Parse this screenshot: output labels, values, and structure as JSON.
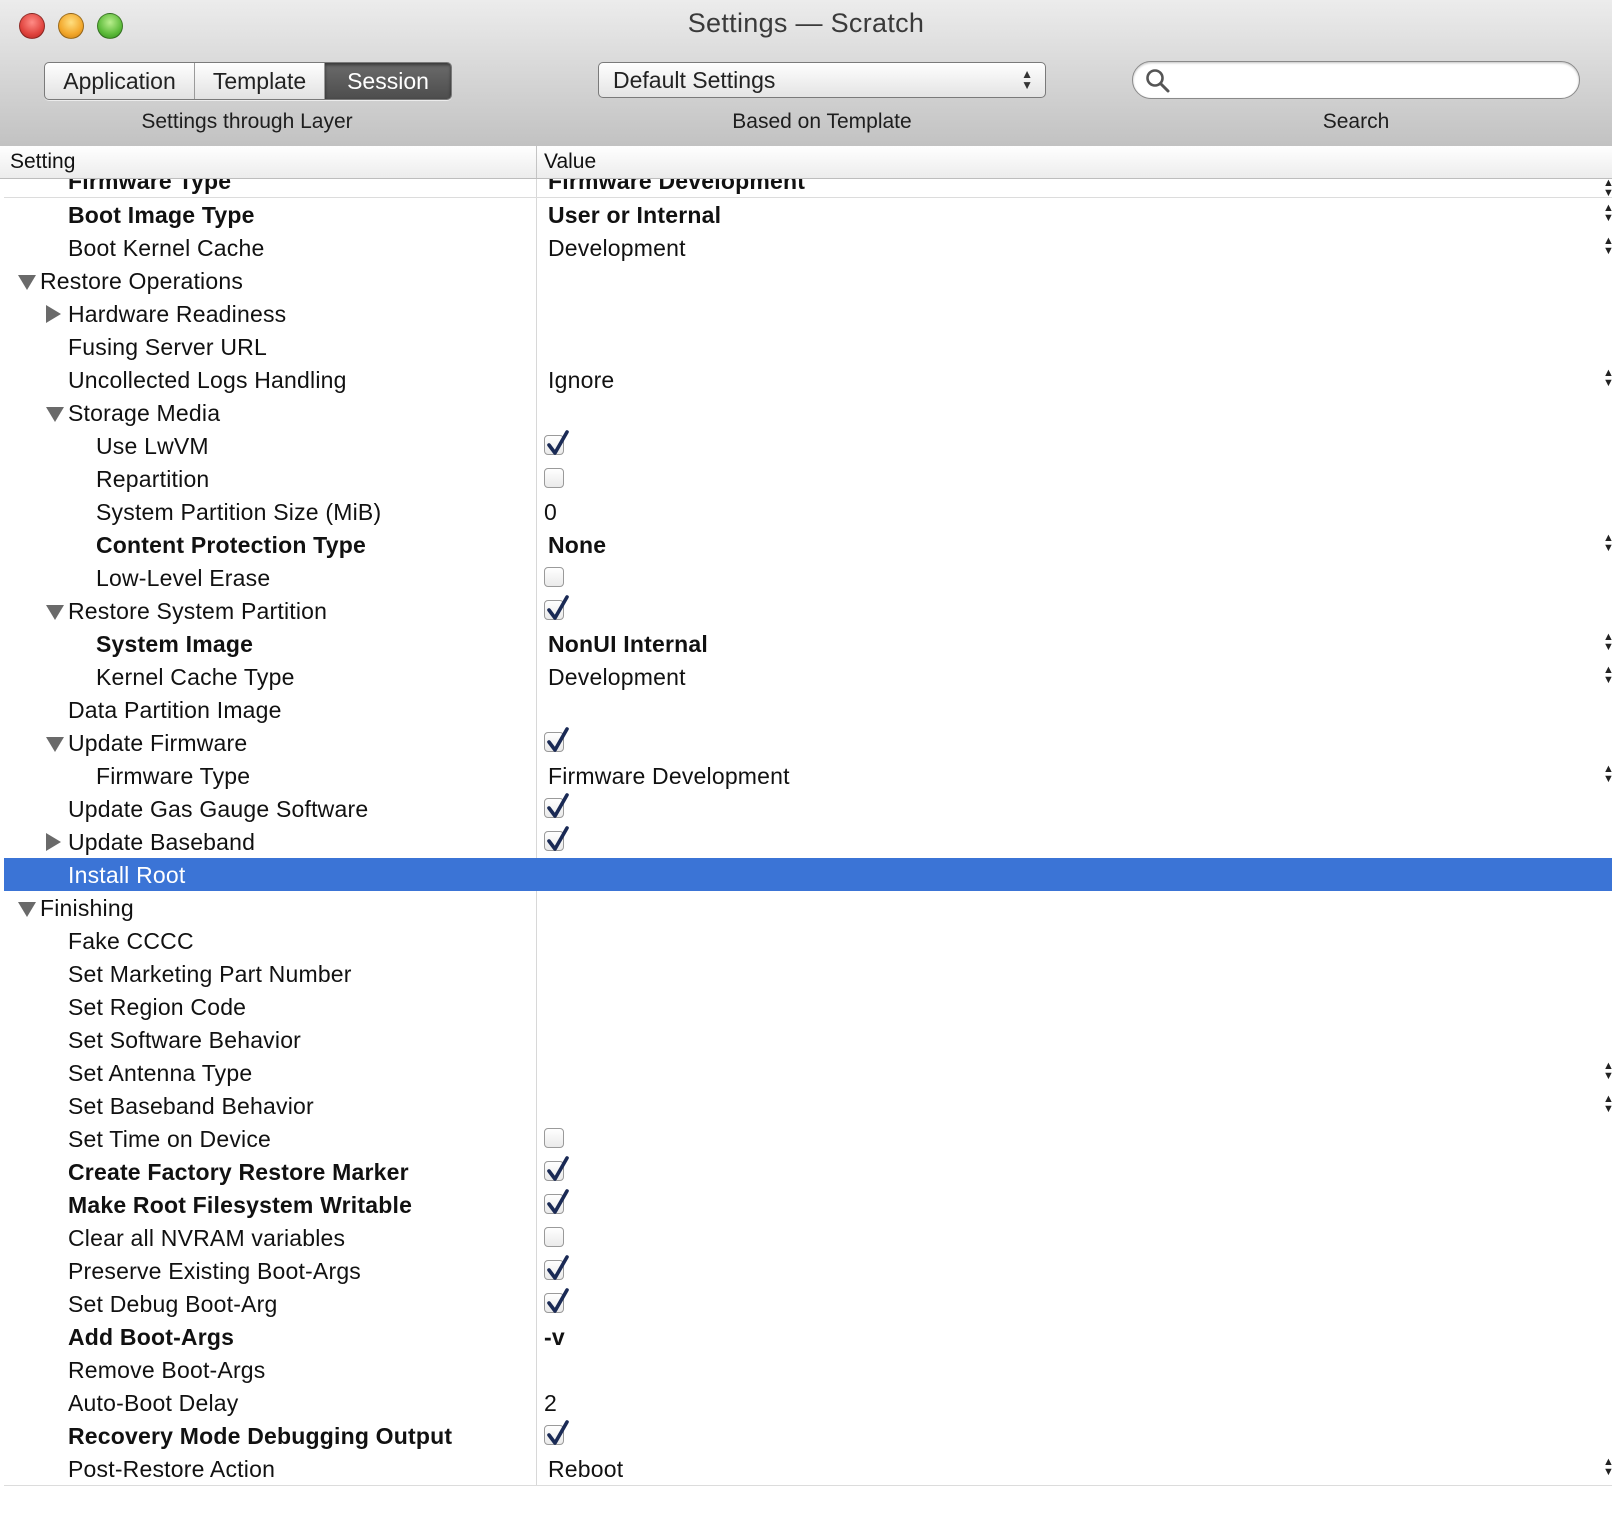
{
  "window": {
    "title": "Settings — Scratch"
  },
  "toolbar": {
    "segments": [
      "Application",
      "Template",
      "Session"
    ],
    "active_segment": "Session",
    "template_popup_value": "Default Settings",
    "search_placeholder": "",
    "label_layer": "Settings through Layer",
    "label_template": "Based on Template",
    "label_search": "Search"
  },
  "table": {
    "headers": {
      "setting": "Setting",
      "value": "Value"
    },
    "selection_color": "#3b74d6",
    "rows": [
      {
        "name": "Firmware Type",
        "indent": 1,
        "bold": true,
        "value": "Firmware Development",
        "kind": "popup",
        "clipped": true
      },
      {
        "name": "Boot Image Type",
        "indent": 1,
        "bold": true,
        "value": "User or Internal",
        "kind": "popup"
      },
      {
        "name": "Boot Kernel Cache",
        "indent": 1,
        "value": "Development",
        "kind": "popup"
      },
      {
        "name": "Restore Operations",
        "indent": 0,
        "disclosure": "open",
        "kind": "none"
      },
      {
        "name": "Hardware Readiness",
        "indent": 1,
        "disclosure": "closed",
        "kind": "none"
      },
      {
        "name": "Fusing Server URL",
        "indent": 1,
        "kind": "none"
      },
      {
        "name": "Uncollected Logs Handling",
        "indent": 1,
        "value": "Ignore",
        "kind": "popup"
      },
      {
        "name": "Storage Media",
        "indent": 1,
        "disclosure": "open",
        "kind": "none"
      },
      {
        "name": "Use LwVM",
        "indent": 2,
        "kind": "checkbox",
        "checked": true
      },
      {
        "name": "Repartition",
        "indent": 2,
        "kind": "checkbox",
        "checked": false
      },
      {
        "name": "System Partition Size (MiB)",
        "indent": 2,
        "value": "0",
        "kind": "text"
      },
      {
        "name": "Content Protection Type",
        "indent": 2,
        "bold": true,
        "value": "None",
        "kind": "popup"
      },
      {
        "name": "Low-Level Erase",
        "indent": 2,
        "kind": "checkbox",
        "checked": false
      },
      {
        "name": "Restore System Partition",
        "indent": 1,
        "disclosure": "open",
        "kind": "checkbox",
        "checked": true
      },
      {
        "name": "System Image",
        "indent": 2,
        "bold": true,
        "value": "NonUI Internal",
        "kind": "popup"
      },
      {
        "name": "Kernel Cache Type",
        "indent": 2,
        "value": "Development",
        "kind": "popup"
      },
      {
        "name": "Data Partition Image",
        "indent": 1,
        "kind": "none"
      },
      {
        "name": "Update Firmware",
        "indent": 1,
        "disclosure": "open",
        "kind": "checkbox",
        "checked": true
      },
      {
        "name": "Firmware Type",
        "indent": 2,
        "value": "Firmware Development",
        "kind": "popup"
      },
      {
        "name": "Update Gas Gauge Software",
        "indent": 1,
        "kind": "checkbox",
        "checked": true
      },
      {
        "name": "Update Baseband",
        "indent": 1,
        "disclosure": "closed",
        "kind": "checkbox",
        "checked": true
      },
      {
        "name": "Install Root",
        "indent": 1,
        "kind": "none",
        "selected": true
      },
      {
        "name": "Finishing",
        "indent": 0,
        "disclosure": "open",
        "kind": "none"
      },
      {
        "name": "Fake CCCC",
        "indent": 1,
        "kind": "none"
      },
      {
        "name": "Set Marketing Part Number",
        "indent": 1,
        "kind": "none"
      },
      {
        "name": "Set Region Code",
        "indent": 1,
        "kind": "none"
      },
      {
        "name": "Set Software Behavior",
        "indent": 1,
        "kind": "none"
      },
      {
        "name": "Set Antenna Type",
        "indent": 1,
        "value": "",
        "kind": "popup"
      },
      {
        "name": "Set Baseband Behavior",
        "indent": 1,
        "value": "",
        "kind": "popup"
      },
      {
        "name": "Set Time on Device",
        "indent": 1,
        "kind": "checkbox",
        "checked": false
      },
      {
        "name": "Create Factory Restore Marker",
        "indent": 1,
        "bold": true,
        "kind": "checkbox",
        "checked": true
      },
      {
        "name": "Make Root Filesystem Writable",
        "indent": 1,
        "bold": true,
        "kind": "checkbox",
        "checked": true
      },
      {
        "name": "Clear all NVRAM variables",
        "indent": 1,
        "kind": "checkbox",
        "checked": false
      },
      {
        "name": "Preserve Existing Boot-Args",
        "indent": 1,
        "kind": "checkbox",
        "checked": true
      },
      {
        "name": "Set Debug Boot-Arg",
        "indent": 1,
        "kind": "checkbox",
        "checked": true
      },
      {
        "name": "Add Boot-Args",
        "indent": 1,
        "bold": true,
        "value": "-v",
        "kind": "text"
      },
      {
        "name": "Remove Boot-Args",
        "indent": 1,
        "kind": "none"
      },
      {
        "name": "Auto-Boot Delay",
        "indent": 1,
        "value": "2",
        "kind": "text"
      },
      {
        "name": "Recovery Mode Debugging Output",
        "indent": 1,
        "bold": true,
        "kind": "checkbox",
        "checked": true
      },
      {
        "name": "Post-Restore Action",
        "indent": 1,
        "value": "Reboot",
        "kind": "popup"
      }
    ]
  }
}
